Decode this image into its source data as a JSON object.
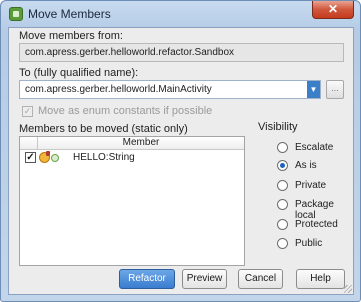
{
  "window": {
    "title": "Move Members",
    "close_glyph": "✕"
  },
  "from": {
    "label": "Move members from:",
    "value": "com.apress.gerber.helloworld.refactor.Sandbox"
  },
  "to": {
    "label": "To (fully qualified name):",
    "value": "com.apress.gerber.helloworld.MainActivity",
    "dropdown_glyph": "▼",
    "browse_label": "..."
  },
  "enum_option": {
    "label": "Move as enum constants if possible",
    "checked": true,
    "disabled": true,
    "check_glyph": "✓"
  },
  "members": {
    "label": "Members to be moved (static only)",
    "column_header": "Member",
    "rows": [
      {
        "checked": true,
        "check_glyph": "✓",
        "icon": "field-icon",
        "text": "HELLO:String"
      }
    ]
  },
  "visibility": {
    "label": "Visibility",
    "options": [
      {
        "label": "Escalate",
        "checked": false
      },
      {
        "label": "As is",
        "checked": true
      },
      {
        "label": "Private",
        "checked": false
      },
      {
        "label": "Package local",
        "checked": false
      },
      {
        "label": "Protected",
        "checked": false
      },
      {
        "label": "Public",
        "checked": false
      }
    ]
  },
  "buttons": {
    "refactor": "Refactor",
    "preview": "Preview",
    "cancel": "Cancel",
    "help": "Help"
  },
  "colors": {
    "accent": "#3a7ccf",
    "title_bar": "#c7daef",
    "close": "#c53a1e"
  }
}
